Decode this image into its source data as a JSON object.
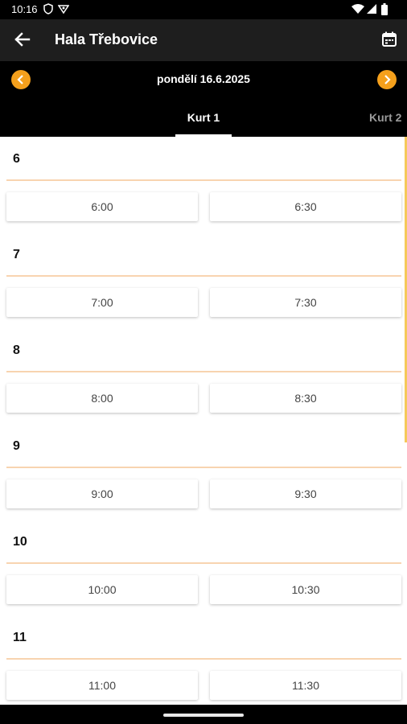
{
  "status_bar": {
    "time": "10:16",
    "icons": [
      "shield-icon",
      "vpn-icon",
      "wifi-icon",
      "signal-icon",
      "battery-icon"
    ]
  },
  "app_bar": {
    "title": "Hala Třebovice",
    "back_icon": "arrow-back-icon",
    "calendar_icon": "calendar-icon"
  },
  "date_nav": {
    "date": "pondělí 16.6.2025",
    "prev_icon": "chevron-left-icon",
    "next_icon": "chevron-right-icon"
  },
  "tabs": [
    {
      "label": "Kurt 1",
      "active": true
    },
    {
      "label": "Kurt 2",
      "active": false
    }
  ],
  "hours": [
    {
      "hour": "6",
      "slots": [
        "6:00",
        "6:30"
      ]
    },
    {
      "hour": "7",
      "slots": [
        "7:00",
        "7:30"
      ]
    },
    {
      "hour": "8",
      "slots": [
        "8:00",
        "8:30"
      ]
    },
    {
      "hour": "9",
      "slots": [
        "9:00",
        "9:30"
      ]
    },
    {
      "hour": "10",
      "slots": [
        "10:00",
        "10:30"
      ]
    },
    {
      "hour": "11",
      "slots": [
        "11:00",
        "11:30"
      ]
    }
  ],
  "colors": {
    "accent": "#f5a01c",
    "app_bar": "#1e1e1e",
    "divider": "#f8d4b0",
    "slot_text": "#444444"
  }
}
